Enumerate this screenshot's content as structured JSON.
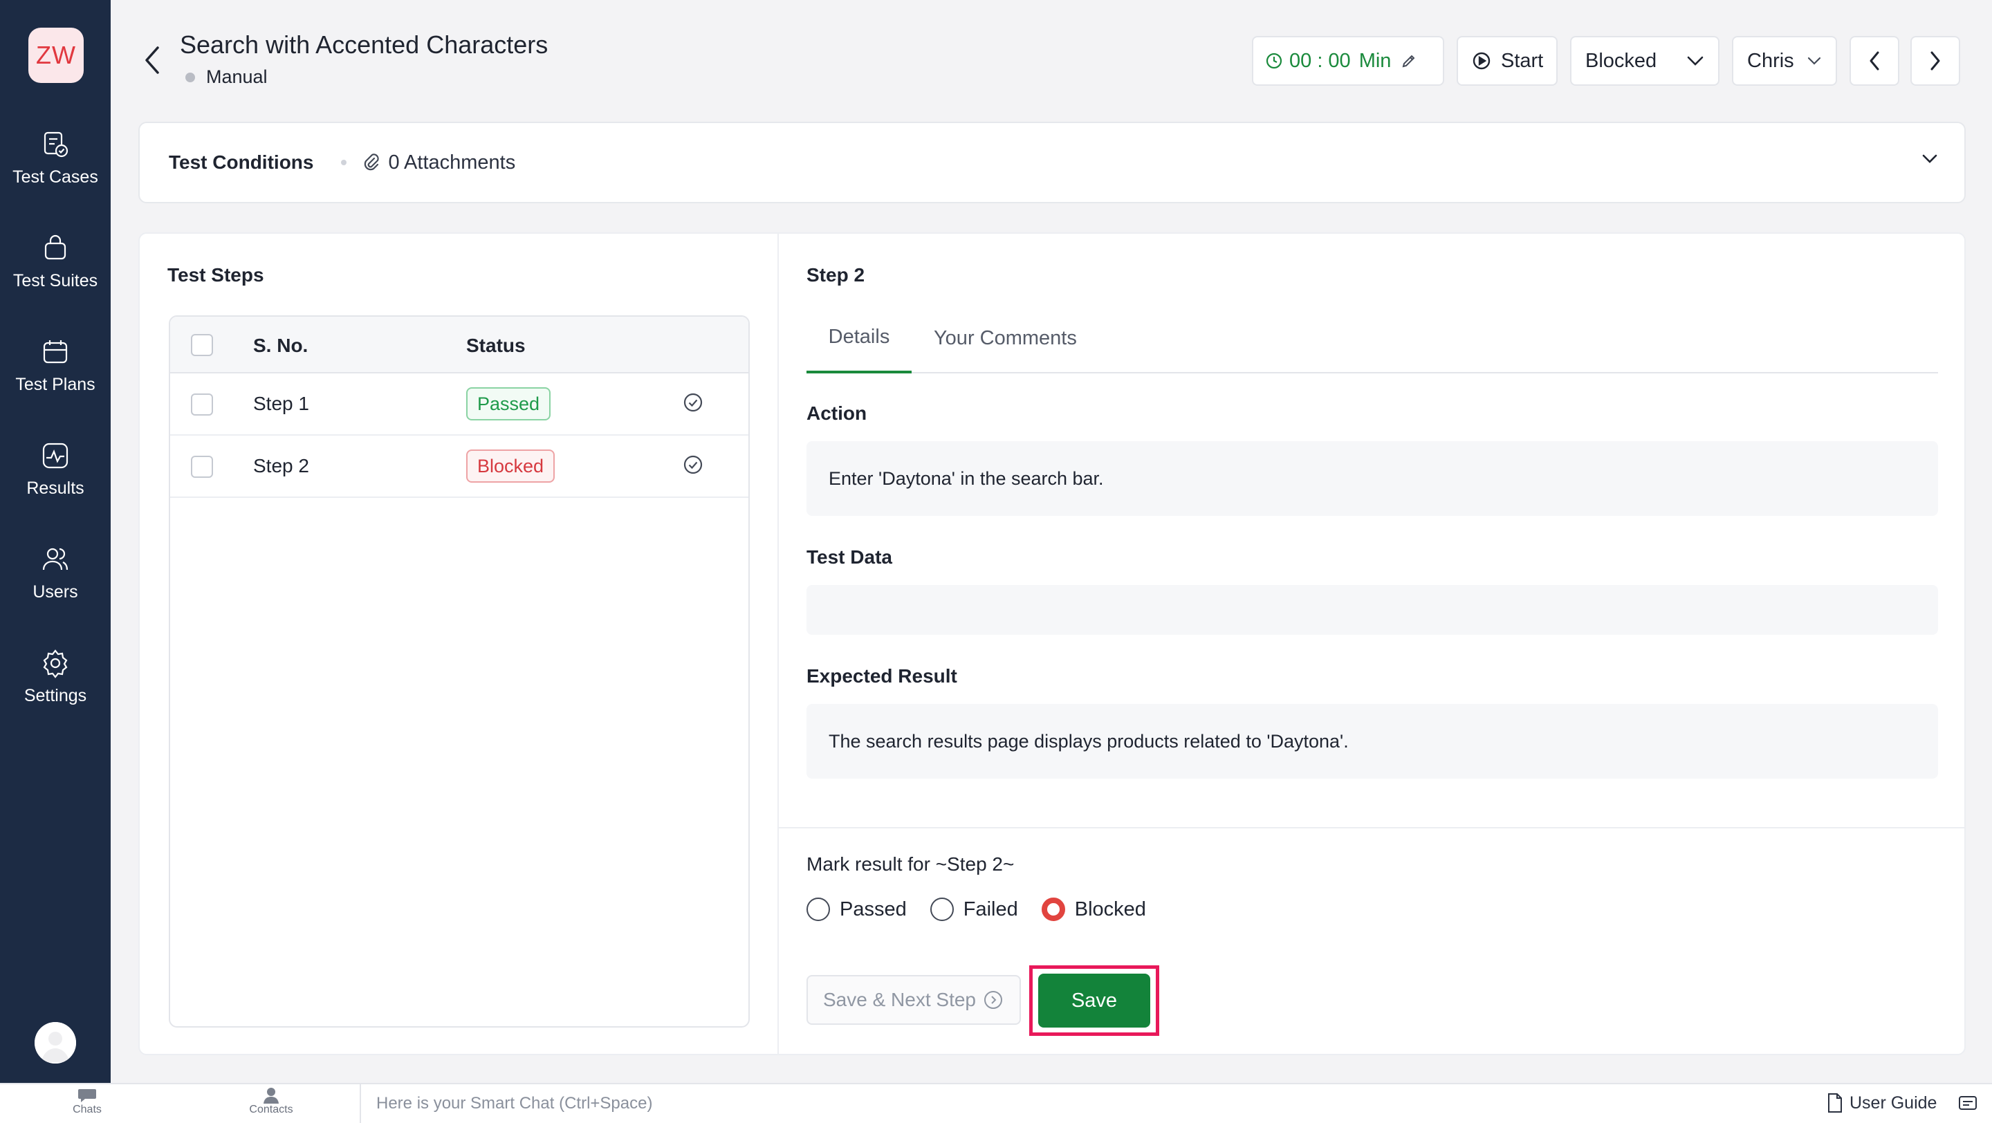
{
  "sidebar": {
    "logo": "ZW",
    "items": [
      {
        "label": "Test Cases",
        "icon": "test-cases-icon"
      },
      {
        "label": "Test Suites",
        "icon": "test-suites-icon"
      },
      {
        "label": "Test Plans",
        "icon": "test-plans-icon"
      },
      {
        "label": "Results",
        "icon": "results-icon"
      },
      {
        "label": "Users",
        "icon": "users-icon"
      },
      {
        "label": "Settings",
        "icon": "settings-icon"
      }
    ]
  },
  "header": {
    "title": "Search with Accented Characters",
    "type": "Manual",
    "timer": {
      "value": "00 : 00",
      "unit": "Min"
    },
    "start_label": "Start",
    "status": "Blocked",
    "assignee": "Chris"
  },
  "conditions": {
    "title": "Test Conditions",
    "attachments": "0 Attachments"
  },
  "test_steps": {
    "title": "Test Steps",
    "columns": {
      "sno": "S. No.",
      "status": "Status"
    },
    "rows": [
      {
        "sno": "Step 1",
        "status": "Passed"
      },
      {
        "sno": "Step 2",
        "status": "Blocked"
      }
    ]
  },
  "step_detail": {
    "title": "Step 2",
    "tabs": [
      "Details",
      "Your Comments"
    ],
    "action_label": "Action",
    "action_value": "Enter 'Daytona' in the search bar.",
    "test_data_label": "Test Data",
    "test_data_value": "",
    "expected_label": "Expected Result",
    "expected_value": "The search results page displays products related to 'Daytona'.",
    "mark_label": "Mark result for ~Step 2~",
    "options": [
      "Passed",
      "Failed",
      "Blocked"
    ],
    "selected": "Blocked",
    "save_next_label": "Save & Next Step",
    "save_label": "Save"
  },
  "bottombar": {
    "chats": "Chats",
    "contacts": "Contacts",
    "smart_chat_placeholder": "Here is your Smart Chat (Ctrl+Space)",
    "user_guide": "User Guide"
  },
  "colors": {
    "sidebar": "#1c2b44",
    "accent_green": "#13833a",
    "blocked_red": "#d6393f",
    "highlight": "#e8195a"
  }
}
